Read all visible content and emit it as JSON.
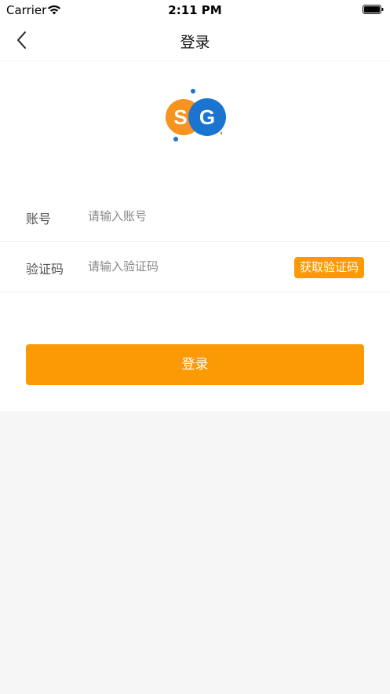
{
  "status_bar": {
    "carrier": "Carrier",
    "time": "2:11 PM"
  },
  "nav": {
    "title": "登录",
    "back_icon": "chevron-left-icon"
  },
  "logo": {
    "letter_left": "S",
    "letter_right": "G",
    "color_left": "#f7931e",
    "color_right": "#1b75d0"
  },
  "form": {
    "account_label": "账号",
    "account_placeholder": "请输入账号",
    "account_value": "",
    "code_label": "验证码",
    "code_placeholder": "请输入验证码",
    "code_value": "",
    "get_code_label": "获取验证码"
  },
  "actions": {
    "login_label": "登录"
  },
  "colors": {
    "accent": "#fb9a05",
    "background": "#f6f6f6",
    "surface": "#ffffff"
  }
}
